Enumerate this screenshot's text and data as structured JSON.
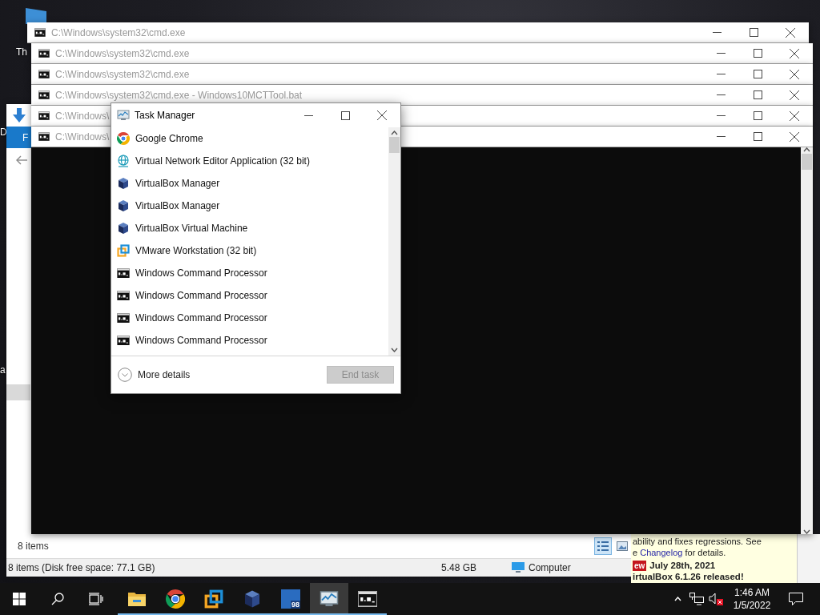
{
  "desktop": {
    "labels": [
      "Th",
      "D",
      "a"
    ]
  },
  "explorer": {
    "ribbon_tab": "F",
    "item_count": "8 items",
    "view_buttons": [
      {
        "kind": "details",
        "selected": true
      },
      {
        "kind": "large_icons",
        "selected": false
      }
    ],
    "status_bar": {
      "summary": "8 items (Disk free space: 77.1 GB)",
      "size": "5.48 GB",
      "location": "Computer"
    }
  },
  "browser_page": {
    "line_1": "ability and fixes regressions. See",
    "line_2": {
      "prefix": "e ",
      "link": "Changelog",
      "suffix": " for details."
    },
    "badge": "ew",
    "date": "July 28th, 2021",
    "headline": "irtualBox 6.1.26 released!"
  },
  "cmd_windows": [
    {
      "title": "C:\\Windows\\system32\\cmd.exe"
    },
    {
      "title": "C:\\Windows\\system32\\cmd.exe"
    },
    {
      "title": "C:\\Windows\\system32\\cmd.exe"
    },
    {
      "title": "C:\\Windows\\system32\\cmd.exe - Windows10MCTTool.bat"
    },
    {
      "title": "C:\\Windows\\"
    },
    {
      "title": "C:\\Windows\\"
    }
  ],
  "task_manager": {
    "title": "Task Manager",
    "apps": [
      {
        "name": "Google Chrome",
        "kind": "chrome"
      },
      {
        "name": "Virtual Network Editor Application (32 bit)",
        "kind": "network"
      },
      {
        "name": "VirtualBox Manager",
        "kind": "virtualbox"
      },
      {
        "name": "VirtualBox Manager",
        "kind": "virtualbox"
      },
      {
        "name": "VirtualBox Virtual Machine",
        "kind": "virtualbox"
      },
      {
        "name": "VMware Workstation (32 bit)",
        "kind": "vmware"
      },
      {
        "name": "Windows Command Processor",
        "kind": "cmd"
      },
      {
        "name": "Windows Command Processor",
        "kind": "cmd"
      },
      {
        "name": "Windows Command Processor",
        "kind": "cmd"
      },
      {
        "name": "Windows Command Processor",
        "kind": "cmd"
      }
    ],
    "more_details": "More details",
    "end_task": {
      "label": "End task",
      "disabled": true
    }
  },
  "taskbar": {
    "apps": [
      {
        "kind": "explorer",
        "running": true,
        "selected": false
      },
      {
        "kind": "chrome",
        "running": true,
        "selected": false
      },
      {
        "kind": "vmware",
        "running": true,
        "selected": false
      },
      {
        "kind": "virtualbox",
        "running": true,
        "selected": false
      },
      {
        "kind": "vm98",
        "badge": "98",
        "running": true,
        "selected": false
      },
      {
        "kind": "taskmanager",
        "running": true,
        "selected": true
      },
      {
        "kind": "cmd",
        "running": true,
        "selected": false
      }
    ],
    "clock": {
      "time": "1:46 AM",
      "date": "1/5/2022"
    }
  }
}
